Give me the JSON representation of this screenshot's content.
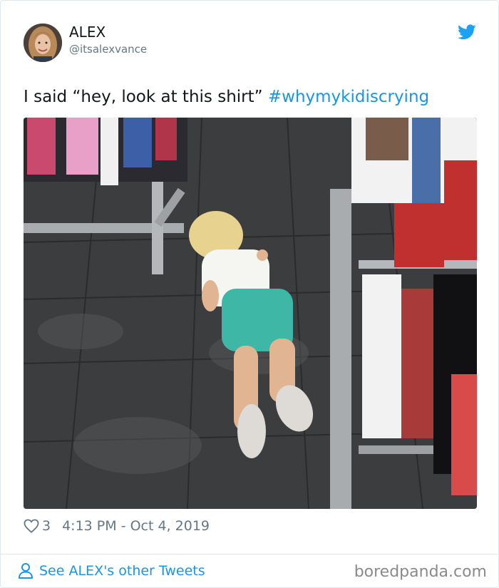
{
  "tweet": {
    "display_name": "ALEX",
    "handle": "@itsalexvance",
    "text": "I said “hey, look at this shirt” ",
    "hashtag": "#whymykidiscrying",
    "like_count": "3",
    "timestamp": "4:13 PM - Oct 4, 2019"
  },
  "footer": {
    "other_tweets_link": "See ALEX's other Tweets",
    "watermark": "boredpanda.com"
  },
  "icons": {
    "logo": "twitter-bird-icon",
    "like": "heart-icon",
    "profile": "person-icon"
  },
  "colors": {
    "brand": "#1da1f2",
    "link": "#1b95e0",
    "secondary_text": "#657786"
  }
}
